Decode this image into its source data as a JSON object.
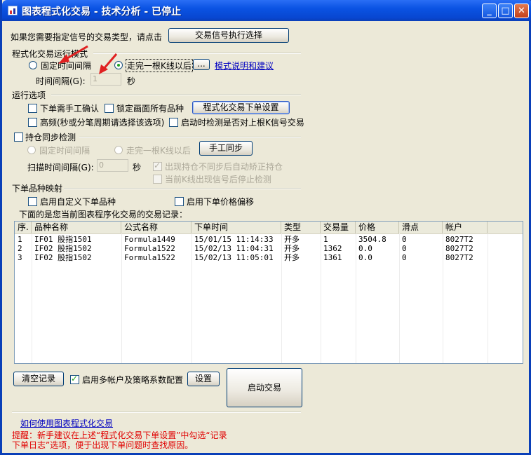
{
  "window": {
    "title": "图表程式化交易 - 技术分析 - 已停止",
    "min_label": "_",
    "max_label": "□",
    "close_label": "✕"
  },
  "signal_prompt": "如果您需要指定信号的交易类型，请点击",
  "signal_button": "交易信号执行选择",
  "mode": {
    "section_label": "程式化交易运行模式",
    "fixed_interval": "固定时间间隔",
    "after_kline": "走完一根K线以后",
    "more_button": "...",
    "help_link": "模式说明和建议",
    "interval_label": "时间间隔(G):",
    "interval_value": "1",
    "interval_unit": "秒"
  },
  "run_options": {
    "section_label": "运行选项",
    "manual_confirm": "下单需手工确认",
    "lock_all": "锁定画面所有品种",
    "order_settings_button": "程式化交易下单设置",
    "high_freq": "高频(秒或分笔周期请选择该选项)",
    "check_last_kline": "启动时检测是否对上根K信号交易"
  },
  "position_sync": {
    "section_label": "持仓同步检测",
    "fixed_interval": "固定时间间隔",
    "after_kline": "走完一根K线以后",
    "manual_sync_button": "手工同步",
    "scan_label": "扫描时间间隔(G):",
    "scan_value": "0",
    "scan_unit": "秒",
    "auto_correct": "出现持仓不同步后自动矫正持仓",
    "stop_check": "当前K线出现信号后停止检测"
  },
  "order_mapping": {
    "section_label": "下单品种映射",
    "custom_symbol": "启用自定义下单品种",
    "price_offset": "启用下单价格偏移"
  },
  "records_caption": "下面的是您当前图表程序化交易的交易记录：",
  "table": {
    "headers": [
      "序.",
      "品种名称",
      "公式名称",
      "下单时间",
      "类型",
      "交易量",
      "价格",
      "滑点",
      "帐户"
    ],
    "rows": [
      [
        "1",
        "IF01 股指1501",
        "Formula1449",
        "15/01/15 11:14:33",
        "开多",
        "1",
        "3504.8",
        "0",
        "8027T2"
      ],
      [
        "2",
        "IF02 股指1502",
        "Formula1522",
        "15/02/13 11:04:31",
        "开多",
        "1362",
        "0.0",
        "0",
        "8027T2"
      ],
      [
        "3",
        "IF02 股指1502",
        "Formula1522",
        "15/02/13 11:05:01",
        "开多",
        "1361",
        "0.0",
        "0",
        "8027T2"
      ]
    ]
  },
  "bottom": {
    "clear_button": "清空记录",
    "multi_account": "启用多帐户及策略系数配置",
    "settings_button": "设置",
    "start_button": "启动交易",
    "howto_link": "如何使用图表程式化交易",
    "tip_line1": "提醒：新手建议在上述“程式化交易下单设置”中勾选“记录",
    "tip_line2": "下单日志”选项，便于出现下单问题时查找原因。"
  },
  "colors": {
    "title_bar": "#0a53e3",
    "tip_text": "#e00000",
    "link": "#0000c0",
    "annotation_arrow": "#e02020"
  }
}
